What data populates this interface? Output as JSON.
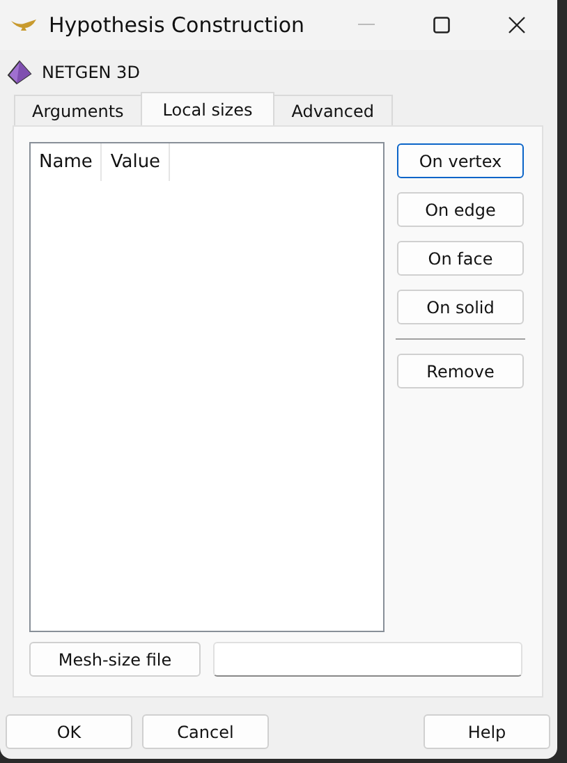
{
  "window": {
    "title": "Hypothesis Construction"
  },
  "header": {
    "label": "NETGEN 3D"
  },
  "tabs": [
    {
      "label": "Arguments",
      "selected": false
    },
    {
      "label": "Local sizes",
      "selected": true
    },
    {
      "label": "Advanced",
      "selected": false
    }
  ],
  "table": {
    "columns": [
      "Name",
      "Value"
    ]
  },
  "side_buttons": [
    {
      "label": "On vertex",
      "focused": true
    },
    {
      "label": "On edge",
      "focused": false
    },
    {
      "label": "On face",
      "focused": false
    },
    {
      "label": "On solid",
      "focused": false
    }
  ],
  "remove_button": "Remove",
  "mesh_size": {
    "button": "Mesh-size file"
  },
  "buttons": [
    "OK",
    "Cancel",
    "Help"
  ]
}
